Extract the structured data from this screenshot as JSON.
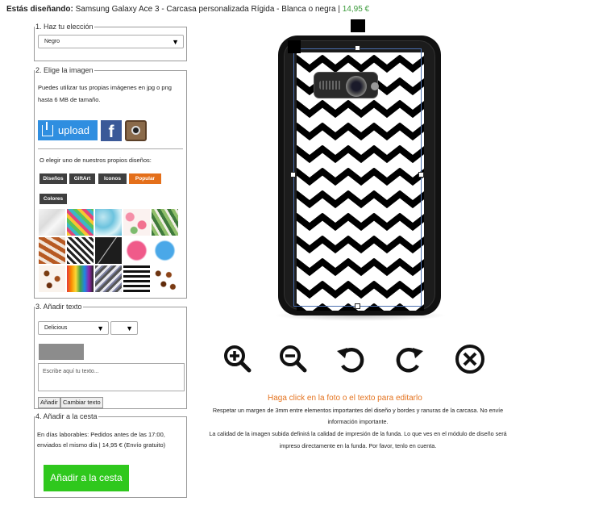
{
  "header": {
    "label": "Estás diseñando:",
    "product": "Samsung Galaxy Ace 3 - Carcasa personalizada Rígida - Blanca o negra",
    "separator": "|",
    "price": "14,95 €"
  },
  "step1": {
    "legend": "1. Haz tu elección",
    "select_value": "Negro"
  },
  "step2": {
    "legend": "2. Elige la imagen",
    "instructions": "Puedes utilizar tus propias imágenes en jpg o png hasta 6 MB de tamaño.",
    "upload_label": "upload",
    "facebook_glyph": "f",
    "or_choose": "O elegir uno de nuestros propios diseños:",
    "tabs": [
      "Diseños",
      "GiftArt",
      "Iconos",
      "Popular",
      "Colores"
    ],
    "active_tab": "Popular",
    "design_tiles": [
      "marble",
      "tropical-pineapple",
      "blue-marble",
      "flamingos",
      "palm-leaves",
      "chocolate-bars",
      "chevron-bw",
      "black-marble",
      "pink-heart",
      "blue-heart",
      "coffee-beans",
      "rainbow-pencils",
      "chevron-stripes",
      "bw-stripes",
      "coffee-beans-2"
    ]
  },
  "step3": {
    "legend": "3. Añadir texto",
    "font_value": "Delicious",
    "size_value": "",
    "text_color": "#8c8c8c",
    "textarea_placeholder": "Escribe aquí tu texto...",
    "add_button": "Añadir",
    "change_text_button": "Cambiar texto"
  },
  "step4": {
    "legend": "4. Añadir a la cesta",
    "delivery_line1": "En días laborables: Pedidos antes de las 17:00,",
    "delivery_line2": "enviados el mismo día | 14,95 € (Envío gratuito)",
    "cart_button": "Añadir a la cesta"
  },
  "editor": {
    "tools": [
      "zoom-in",
      "zoom-out",
      "rotate-left",
      "rotate-right",
      "delete"
    ],
    "click_hint": "Haga click en la foto o el texto para editarlo",
    "notice_lines": [
      "Respetar un margen de 3mm entre elementos importantes del diseño y bordes y ranuras de la carcasa. No envíe",
      "información importante.",
      "La calidad de la imagen subida definirá la calidad de impresión de la funda. Lo que ves en el módulo de diseño será",
      "impreso directamente en la funda. Por favor, tenlo en cuenta."
    ]
  },
  "colors": {
    "accent_green": "#2fc81d",
    "tab_active": "#e46f1a",
    "upload_blue": "#2f8ee0",
    "hint_orange": "#e4731f"
  }
}
